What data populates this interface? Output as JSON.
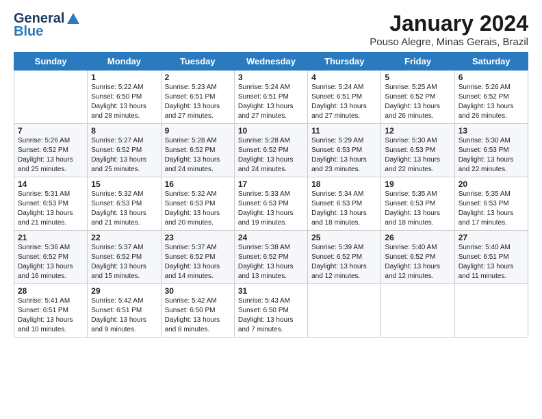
{
  "header": {
    "logo_line1": "General",
    "logo_line2": "Blue",
    "title": "January 2024",
    "location": "Pouso Alegre, Minas Gerais, Brazil"
  },
  "weekdays": [
    "Sunday",
    "Monday",
    "Tuesday",
    "Wednesday",
    "Thursday",
    "Friday",
    "Saturday"
  ],
  "weeks": [
    [
      {
        "day": "",
        "info": ""
      },
      {
        "day": "1",
        "info": "Sunrise: 5:22 AM\nSunset: 6:50 PM\nDaylight: 13 hours\nand 28 minutes."
      },
      {
        "day": "2",
        "info": "Sunrise: 5:23 AM\nSunset: 6:51 PM\nDaylight: 13 hours\nand 27 minutes."
      },
      {
        "day": "3",
        "info": "Sunrise: 5:24 AM\nSunset: 6:51 PM\nDaylight: 13 hours\nand 27 minutes."
      },
      {
        "day": "4",
        "info": "Sunrise: 5:24 AM\nSunset: 6:51 PM\nDaylight: 13 hours\nand 27 minutes."
      },
      {
        "day": "5",
        "info": "Sunrise: 5:25 AM\nSunset: 6:52 PM\nDaylight: 13 hours\nand 26 minutes."
      },
      {
        "day": "6",
        "info": "Sunrise: 5:26 AM\nSunset: 6:52 PM\nDaylight: 13 hours\nand 26 minutes."
      }
    ],
    [
      {
        "day": "7",
        "info": "Sunrise: 5:26 AM\nSunset: 6:52 PM\nDaylight: 13 hours\nand 25 minutes."
      },
      {
        "day": "8",
        "info": "Sunrise: 5:27 AM\nSunset: 6:52 PM\nDaylight: 13 hours\nand 25 minutes."
      },
      {
        "day": "9",
        "info": "Sunrise: 5:28 AM\nSunset: 6:52 PM\nDaylight: 13 hours\nand 24 minutes."
      },
      {
        "day": "10",
        "info": "Sunrise: 5:28 AM\nSunset: 6:52 PM\nDaylight: 13 hours\nand 24 minutes."
      },
      {
        "day": "11",
        "info": "Sunrise: 5:29 AM\nSunset: 6:53 PM\nDaylight: 13 hours\nand 23 minutes."
      },
      {
        "day": "12",
        "info": "Sunrise: 5:30 AM\nSunset: 6:53 PM\nDaylight: 13 hours\nand 22 minutes."
      },
      {
        "day": "13",
        "info": "Sunrise: 5:30 AM\nSunset: 6:53 PM\nDaylight: 13 hours\nand 22 minutes."
      }
    ],
    [
      {
        "day": "14",
        "info": "Sunrise: 5:31 AM\nSunset: 6:53 PM\nDaylight: 13 hours\nand 21 minutes."
      },
      {
        "day": "15",
        "info": "Sunrise: 5:32 AM\nSunset: 6:53 PM\nDaylight: 13 hours\nand 21 minutes."
      },
      {
        "day": "16",
        "info": "Sunrise: 5:32 AM\nSunset: 6:53 PM\nDaylight: 13 hours\nand 20 minutes."
      },
      {
        "day": "17",
        "info": "Sunrise: 5:33 AM\nSunset: 6:53 PM\nDaylight: 13 hours\nand 19 minutes."
      },
      {
        "day": "18",
        "info": "Sunrise: 5:34 AM\nSunset: 6:53 PM\nDaylight: 13 hours\nand 18 minutes."
      },
      {
        "day": "19",
        "info": "Sunrise: 5:35 AM\nSunset: 6:53 PM\nDaylight: 13 hours\nand 18 minutes."
      },
      {
        "day": "20",
        "info": "Sunrise: 5:35 AM\nSunset: 6:53 PM\nDaylight: 13 hours\nand 17 minutes."
      }
    ],
    [
      {
        "day": "21",
        "info": "Sunrise: 5:36 AM\nSunset: 6:52 PM\nDaylight: 13 hours\nand 16 minutes."
      },
      {
        "day": "22",
        "info": "Sunrise: 5:37 AM\nSunset: 6:52 PM\nDaylight: 13 hours\nand 15 minutes."
      },
      {
        "day": "23",
        "info": "Sunrise: 5:37 AM\nSunset: 6:52 PM\nDaylight: 13 hours\nand 14 minutes."
      },
      {
        "day": "24",
        "info": "Sunrise: 5:38 AM\nSunset: 6:52 PM\nDaylight: 13 hours\nand 13 minutes."
      },
      {
        "day": "25",
        "info": "Sunrise: 5:39 AM\nSunset: 6:52 PM\nDaylight: 13 hours\nand 12 minutes."
      },
      {
        "day": "26",
        "info": "Sunrise: 5:40 AM\nSunset: 6:52 PM\nDaylight: 13 hours\nand 12 minutes."
      },
      {
        "day": "27",
        "info": "Sunrise: 5:40 AM\nSunset: 6:51 PM\nDaylight: 13 hours\nand 11 minutes."
      }
    ],
    [
      {
        "day": "28",
        "info": "Sunrise: 5:41 AM\nSunset: 6:51 PM\nDaylight: 13 hours\nand 10 minutes."
      },
      {
        "day": "29",
        "info": "Sunrise: 5:42 AM\nSunset: 6:51 PM\nDaylight: 13 hours\nand 9 minutes."
      },
      {
        "day": "30",
        "info": "Sunrise: 5:42 AM\nSunset: 6:50 PM\nDaylight: 13 hours\nand 8 minutes."
      },
      {
        "day": "31",
        "info": "Sunrise: 5:43 AM\nSunset: 6:50 PM\nDaylight: 13 hours\nand 7 minutes."
      },
      {
        "day": "",
        "info": ""
      },
      {
        "day": "",
        "info": ""
      },
      {
        "day": "",
        "info": ""
      }
    ]
  ]
}
